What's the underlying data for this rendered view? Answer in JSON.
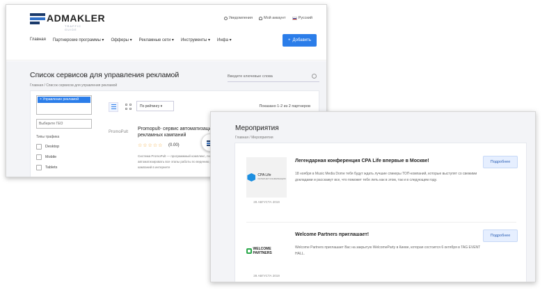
{
  "back": {
    "logo": {
      "name": "ADMAKLER",
      "tagline": "TRAFFIC GUIDE"
    },
    "topbar": {
      "notifications": "Уведомления",
      "account": "Мой аккаунт",
      "language": "Русский"
    },
    "nav": [
      "Главная",
      "Партнерские программы ▾",
      "Офферы ▾",
      "Рекламные сети ▾",
      "Инструменты ▾",
      "Инфа ▾"
    ],
    "add_button": "Добавить",
    "page_title": "Список сервисов для управления рекламой",
    "search_placeholder": "Введите ключевые слова",
    "breadcrumb": "Главная / Список сервисов для управления рекламой",
    "filter_chip": "× Управление рекламой",
    "geo_placeholder": "Выберите ГЕО",
    "traffic_title": "Типы трафика",
    "traffic_types": [
      "Desktop",
      "Mobile",
      "Tablets"
    ],
    "sort": "По рейтингу ▾",
    "count": "Показано 1-2 из 2 партнеров",
    "item": {
      "logo_text": "PromoPult",
      "title": "Promopult- сервис автоматизации рекламных кампаний",
      "stars": "☆☆☆☆☆",
      "rating": "(0.00)",
      "desc": "Система PromoPult — программный комплекс, позволяющий автоматизировать все этапы работы по ведению рекламных кампаний в интернете"
    }
  },
  "front": {
    "title": "Мероприятия",
    "breadcrumb": "Главная / Мероприятия",
    "events": [
      {
        "title": "Легендарная конференция CPA Life впервые в Москве!",
        "desc": "18 ноября в Music Media Dome тебя будут ждать лучшие спикеры ТОП-компаний, которые выступят со свежими докладами и расскажут все, что поможет тебе лить как в этом, так и в следующем году.",
        "date": "28 АВГУСТА 2019",
        "button": "Подробнее",
        "logo_main": "CPA Life",
        "logo_sub": "ИНТЕРНЕТ КОНФЕРЕНЦИЯ"
      },
      {
        "title": "Welcome Partners приглашает!",
        "desc": "Welcome Partners приглашает Вас на закрытую WelcomeParty в Киеве, которая состоится 6 октября в TAG EVENT HALL.",
        "date": "28 АВГУСТА 2019",
        "button": "Подробнее",
        "logo_main": "WELCOME PARTNERS"
      }
    ]
  }
}
